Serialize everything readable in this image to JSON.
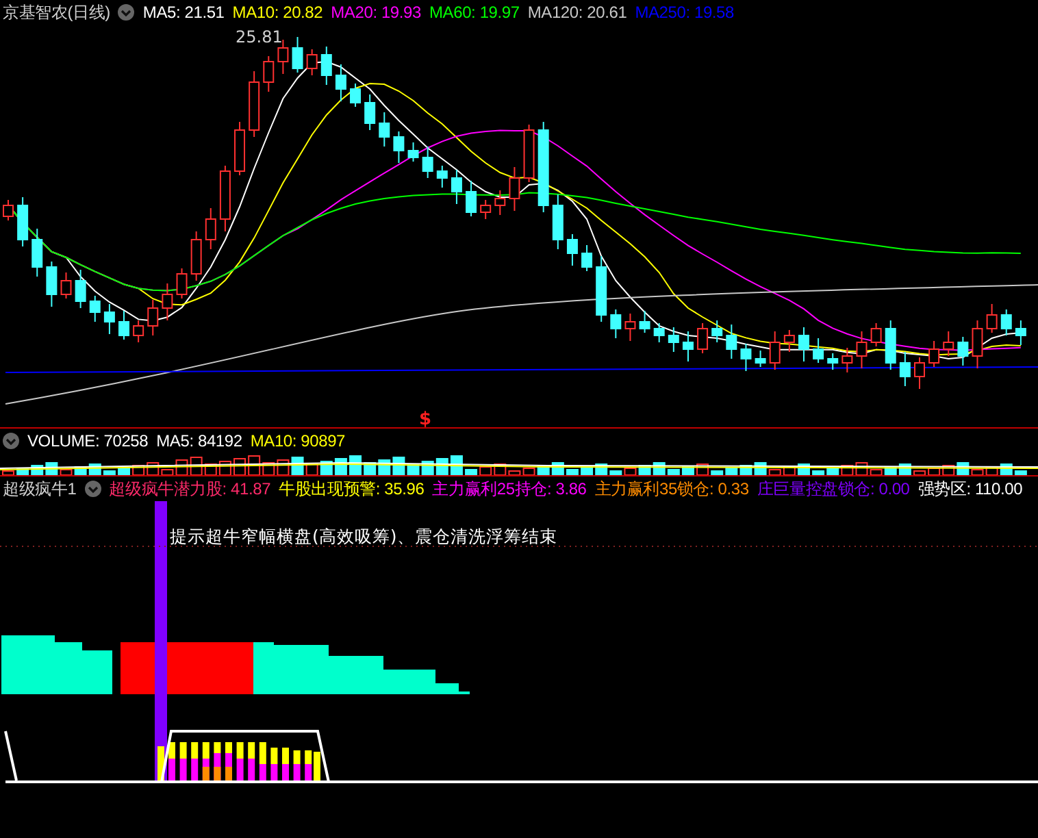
{
  "price_panel": {
    "title": "京基智农(日线)",
    "indicators": [
      {
        "text": "MA5: 21.51",
        "color": "#ffffff"
      },
      {
        "text": "MA10: 20.82",
        "color": "#ffff00"
      },
      {
        "text": "MA20: 19.93",
        "color": "#ff00ff"
      },
      {
        "text": "MA60: 19.97",
        "color": "#00ff00"
      },
      {
        "text": "MA120: 20.61",
        "color": "#c8c8c8"
      },
      {
        "text": "MA250: 19.58",
        "color": "#0000ff"
      }
    ],
    "high_label": "25.81",
    "signal_mark": "$"
  },
  "volume_panel": {
    "indicators": [
      {
        "text": "VOLUME: 70258",
        "color": "#ffffff"
      },
      {
        "text": "MA5: 84192",
        "color": "#ffffff"
      },
      {
        "text": "MA10: 90897",
        "color": "#ffff00"
      }
    ]
  },
  "signal_panel": {
    "title": "超级疯牛1",
    "indicators": [
      {
        "text": "超级疯牛潜力股: 41.87",
        "color": "#ff2a6a"
      },
      {
        "text": "牛股出现预警: 35.96",
        "color": "#ffff00"
      },
      {
        "text": "主力赢利25持仓: 3.86",
        "color": "#ff00ff"
      },
      {
        "text": "主力赢利35锁仓: 0.33",
        "color": "#ff8c00"
      },
      {
        "text": "庄巨量控盘锁仓: 0.00",
        "color": "#8000ff"
      },
      {
        "text": "强势区: 110.00",
        "color": "#ffffff"
      }
    ],
    "note": "提示超牛窄幅横盘(高效吸筹)、震仓清洗浮筹结束"
  }
}
